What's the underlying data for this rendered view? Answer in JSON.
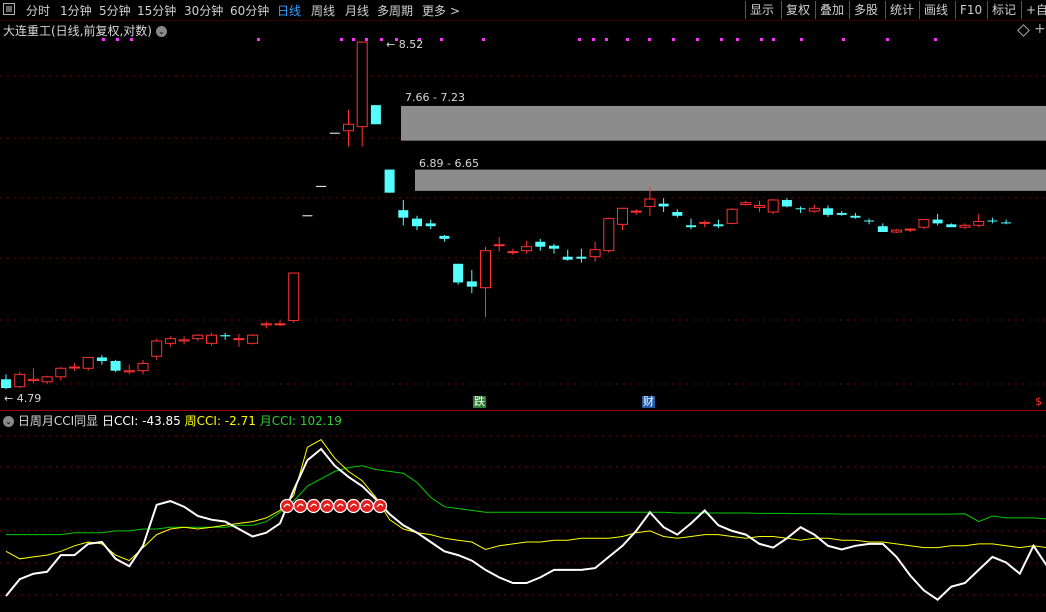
{
  "toolbar": {
    "tabs": [
      "分时",
      "1分钟",
      "5分钟",
      "15分钟",
      "30分钟",
      "60分钟",
      "日线",
      "周线",
      "月线",
      "多周期",
      "更多 >"
    ],
    "active_tab": "日线",
    "right_buttons": [
      "显示",
      "复权",
      "叠加",
      "多股",
      "统计",
      "画线",
      "F10",
      "标记",
      "+自"
    ]
  },
  "chart_title": "大连重工(日线,前复权,对数)",
  "price_labels": {
    "high": "8.52",
    "zone1": "7.66 - 7.23",
    "zone2": "6.89 - 6.65",
    "low": "4.79"
  },
  "markers": {
    "die": "跌",
    "cai": "财",
    "s": "$"
  },
  "indicator": {
    "name": "日周月CCI同显",
    "day_label": "日CCI: -43.85",
    "week_label": "周CCI: -2.71",
    "month_label": "月CCI: 102.19"
  },
  "colors": {
    "up": "#ff3232",
    "down": "#54ffff",
    "day_line": "#ffffff",
    "week_line": "#ffff00",
    "month_line": "#00cc00",
    "active_tab": "#33a0ff"
  },
  "chart_data": {
    "type": "candlestick",
    "price_range": [
      4.79,
      8.52
    ],
    "candles": [
      [
        4.86,
        4.9,
        4.78,
        4.79
      ],
      [
        4.8,
        4.92,
        4.79,
        4.9
      ],
      [
        4.85,
        4.95,
        4.83,
        4.86
      ],
      [
        4.84,
        4.89,
        4.82,
        4.88
      ],
      [
        4.88,
        4.96,
        4.85,
        4.95
      ],
      [
        4.96,
        4.99,
        4.93,
        4.96
      ],
      [
        4.95,
        5.04,
        4.93,
        5.04
      ],
      [
        5.04,
        5.06,
        4.98,
        5.01
      ],
      [
        5.01,
        5.02,
        4.92,
        4.93
      ],
      [
        4.92,
        4.98,
        4.9,
        4.93
      ],
      [
        4.93,
        5.02,
        4.9,
        4.99
      ],
      [
        5.05,
        5.2,
        5.02,
        5.18
      ],
      [
        5.16,
        5.22,
        5.13,
        5.2
      ],
      [
        5.18,
        5.22,
        5.15,
        5.19
      ],
      [
        5.2,
        5.24,
        5.18,
        5.23
      ],
      [
        5.16,
        5.25,
        5.14,
        5.23
      ],
      [
        5.23,
        5.25,
        5.19,
        5.22
      ],
      [
        5.2,
        5.24,
        5.13,
        5.2
      ],
      [
        5.16,
        5.24,
        5.15,
        5.23
      ],
      [
        5.32,
        5.35,
        5.29,
        5.33
      ],
      [
        5.33,
        5.36,
        5.31,
        5.33
      ],
      [
        5.36,
        5.8,
        5.34,
        5.8
      ],
      [
        6.38,
        6.38,
        6.38,
        6.38
      ],
      [
        6.7,
        6.7,
        6.7,
        6.7
      ],
      [
        7.32,
        7.32,
        7.32,
        7.32
      ],
      [
        7.35,
        7.61,
        7.16,
        7.43
      ],
      [
        7.4,
        8.52,
        7.16,
        8.52
      ],
      [
        7.67,
        7.67,
        7.43,
        7.43
      ],
      [
        6.89,
        6.89,
        6.63,
        6.63
      ],
      [
        6.44,
        6.55,
        6.28,
        6.36
      ],
      [
        6.35,
        6.38,
        6.23,
        6.27
      ],
      [
        6.3,
        6.34,
        6.24,
        6.27
      ],
      [
        6.17,
        6.18,
        6.11,
        6.14
      ],
      [
        5.89,
        5.89,
        5.69,
        5.71
      ],
      [
        5.72,
        5.83,
        5.61,
        5.67
      ],
      [
        5.66,
        6.06,
        5.39,
        6.02
      ],
      [
        6.07,
        6.16,
        6.01,
        6.08
      ],
      [
        6.0,
        6.04,
        5.98,
        6.01
      ],
      [
        6.02,
        6.12,
        5.99,
        6.06
      ],
      [
        6.11,
        6.14,
        6.02,
        6.06
      ],
      [
        6.07,
        6.09,
        5.99,
        6.04
      ],
      [
        5.96,
        6.03,
        5.92,
        5.93
      ],
      [
        5.96,
        6.04,
        5.9,
        5.94
      ],
      [
        5.96,
        6.11,
        5.91,
        6.03
      ],
      [
        6.02,
        6.36,
        6.0,
        6.35
      ],
      [
        6.29,
        6.43,
        6.23,
        6.46
      ],
      [
        6.43,
        6.45,
        6.39,
        6.43
      ],
      [
        6.48,
        6.7,
        6.38,
        6.56
      ],
      [
        6.51,
        6.57,
        6.42,
        6.48
      ],
      [
        6.42,
        6.45,
        6.36,
        6.38
      ],
      [
        6.28,
        6.35,
        6.24,
        6.26
      ],
      [
        6.3,
        6.33,
        6.26,
        6.31
      ],
      [
        6.29,
        6.34,
        6.25,
        6.27
      ],
      [
        6.3,
        6.46,
        6.29,
        6.45
      ],
      [
        6.5,
        6.54,
        6.49,
        6.52
      ],
      [
        6.47,
        6.54,
        6.42,
        6.49
      ],
      [
        6.42,
        6.56,
        6.4,
        6.55
      ],
      [
        6.55,
        6.57,
        6.47,
        6.48
      ],
      [
        6.46,
        6.48,
        6.41,
        6.45
      ],
      [
        6.43,
        6.5,
        6.41,
        6.46
      ],
      [
        6.46,
        6.49,
        6.37,
        6.39
      ],
      [
        6.41,
        6.43,
        6.38,
        6.39
      ],
      [
        6.38,
        6.41,
        6.35,
        6.36
      ],
      [
        6.33,
        6.35,
        6.29,
        6.32
      ],
      [
        6.27,
        6.3,
        6.21,
        6.21
      ],
      [
        6.21,
        6.24,
        6.2,
        6.23
      ],
      [
        6.23,
        6.25,
        6.21,
        6.24
      ],
      [
        6.26,
        6.34,
        6.24,
        6.34
      ],
      [
        6.34,
        6.4,
        6.28,
        6.3
      ],
      [
        6.29,
        6.3,
        6.26,
        6.26
      ],
      [
        6.26,
        6.3,
        6.24,
        6.28
      ],
      [
        6.28,
        6.4,
        6.26,
        6.32
      ],
      [
        6.33,
        6.36,
        6.3,
        6.32
      ],
      [
        6.31,
        6.34,
        6.29,
        6.3
      ]
    ],
    "cci": {
      "range": [
        -200,
        300
      ],
      "day": [
        -165,
        -120,
        -105,
        -100,
        -55,
        -55,
        -25,
        -20,
        -65,
        -85,
        -30,
        80,
        90,
        75,
        50,
        40,
        35,
        15,
        -5,
        5,
        30,
        120,
        200,
        230,
        185,
        155,
        130,
        95,
        55,
        25,
        5,
        -20,
        -45,
        -55,
        -70,
        -95,
        -115,
        -130,
        -130,
        -115,
        -95,
        -95,
        -95,
        -90,
        -60,
        -30,
        10,
        60,
        20,
        0,
        30,
        65,
        25,
        10,
        0,
        -25,
        -35,
        -10,
        20,
        0,
        -30,
        -40,
        -30,
        -25,
        -25,
        -60,
        -110,
        -150,
        -175,
        -140,
        -130,
        -95,
        -60,
        -75,
        -105,
        -30,
        -85
      ],
      "week": [
        -45,
        -65,
        -60,
        -55,
        -45,
        -30,
        -20,
        -25,
        -55,
        -70,
        -35,
        0,
        15,
        20,
        15,
        20,
        25,
        30,
        35,
        45,
        65,
        105,
        235,
        255,
        205,
        170,
        145,
        100,
        40,
        15,
        5,
        0,
        -10,
        -15,
        -20,
        -40,
        -30,
        -25,
        -20,
        -20,
        -15,
        -15,
        -10,
        -10,
        -10,
        -5,
        5,
        10,
        -5,
        -10,
        -5,
        0,
        0,
        -5,
        -10,
        -5,
        -5,
        -10,
        -15,
        -10,
        -10,
        -15,
        -15,
        -20,
        -20,
        -25,
        -30,
        -35,
        -35,
        -30,
        -30,
        -25,
        -25,
        -30,
        -35,
        -30,
        -35
      ],
      "month": [
        0,
        0,
        0,
        0,
        0,
        5,
        5,
        5,
        10,
        10,
        15,
        15,
        20,
        20,
        20,
        20,
        20,
        25,
        25,
        35,
        60,
        90,
        130,
        150,
        170,
        180,
        185,
        175,
        170,
        165,
        140,
        100,
        75,
        70,
        65,
        60,
        60,
        60,
        60,
        60,
        60,
        60,
        60,
        60,
        60,
        60,
        60,
        60,
        60,
        58,
        58,
        58,
        58,
        58,
        58,
        57,
        57,
        57,
        56,
        56,
        56,
        55,
        55,
        55,
        55,
        55,
        55,
        55,
        55,
        55,
        56,
        35,
        50,
        45,
        45,
        45,
        42
      ]
    },
    "signal_icon_count": 8
  }
}
